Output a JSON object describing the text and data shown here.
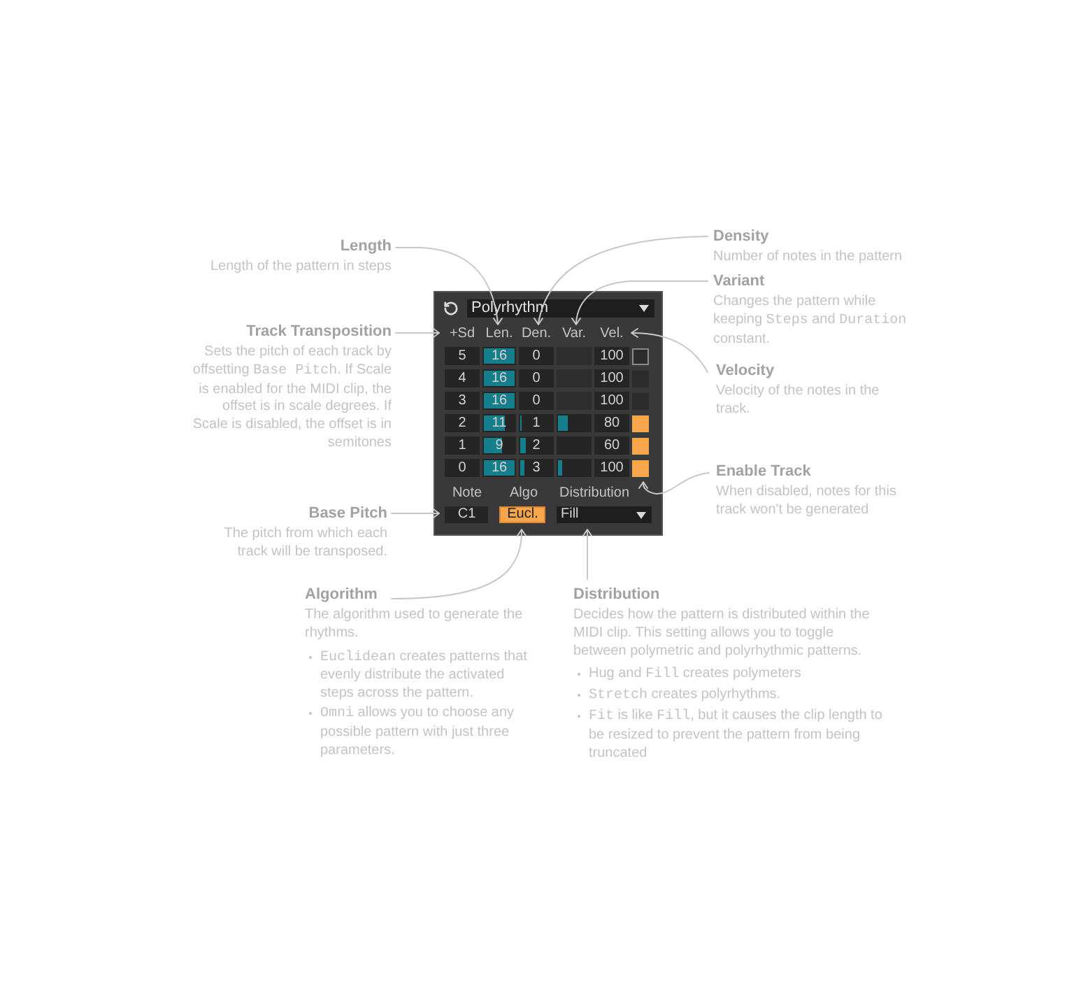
{
  "device": {
    "preset": "Polyrhythm",
    "columns": [
      "+Sd",
      "Len.",
      "Den.",
      "Var.",
      "Vel."
    ],
    "tracks": [
      {
        "transpose": "5",
        "length": {
          "value": "16",
          "level": 1
        },
        "density": {
          "value": "0"
        },
        "velocity": "100",
        "enabled": false,
        "focused": true
      },
      {
        "transpose": "4",
        "length": {
          "value": "16",
          "level": 1
        },
        "density": {
          "value": "0"
        },
        "velocity": "100",
        "enabled": false,
        "focused": false
      },
      {
        "transpose": "3",
        "length": {
          "value": "16",
          "level": 1
        },
        "density": {
          "value": "0"
        },
        "velocity": "100",
        "enabled": false,
        "focused": false
      },
      {
        "transpose": "2",
        "length": {
          "value": "11",
          "level": 0.67
        },
        "density": {
          "value": "1",
          "level": 0.05
        },
        "variant": {
          "level": 0.3
        },
        "velocity": "80",
        "enabled": true,
        "focused": false
      },
      {
        "transpose": "1",
        "length": {
          "value": "9",
          "level": 0.58
        },
        "density": {
          "value": "2",
          "level": 0.17
        },
        "velocity": "60",
        "enabled": true,
        "focused": false
      },
      {
        "transpose": "0",
        "length": {
          "value": "16",
          "level": 1
        },
        "density": {
          "value": "3",
          "level": 0.15
        },
        "variant": {
          "level": 0.15
        },
        "velocity": "100",
        "enabled": true,
        "focused": false
      }
    ],
    "note": {
      "label": "Note",
      "value": "C1"
    },
    "algorithm": {
      "label": "Algo",
      "value": "Eucl.",
      "on": true
    },
    "distribution": {
      "label": "Distribution",
      "value": "Fill"
    }
  },
  "annotations": [
    {
      "title": "Length",
      "body": [
        {
          "text": "Length of the pattern in steps",
          "kind": "text"
        }
      ]
    },
    {
      "title": "Track Transposition",
      "body": [
        {
          "text": "Sets the pitch of each track by offsetting ",
          "kind": "text"
        },
        {
          "text": "Base Pitch",
          "kind": "code"
        },
        {
          "text": ". If Scale is enabled for the MIDI clip, the offset is in scale degrees. If Scale is disabled, the offset is in semitones",
          "kind": "text"
        }
      ]
    },
    {
      "title": "Base Pitch",
      "body": [
        {
          "text": "The pitch from which each track will be transposed.",
          "kind": "text"
        }
      ]
    },
    {
      "title": "Density",
      "body": [
        {
          "text": "Number of notes in the pattern",
          "kind": "text"
        }
      ]
    },
    {
      "title": "Variant",
      "body": [
        {
          "text": "Changes the pattern while keeping ",
          "kind": "text"
        },
        {
          "text": "Steps",
          "kind": "code"
        },
        {
          "text": " and ",
          "kind": "text"
        },
        {
          "text": "Duration",
          "kind": "code"
        },
        {
          "text": " constant.",
          "kind": "text"
        }
      ]
    },
    {
      "title": "Velocity",
      "body": [
        {
          "text": "Velocity of the notes in the track.",
          "kind": "text"
        }
      ]
    },
    {
      "title": "Enable Track",
      "body": [
        {
          "text": "When disabled, notes for this track won't be generated",
          "kind": "text"
        }
      ]
    },
    {
      "title": "Algorithm",
      "body": [
        {
          "text": "The algorithm used to generate the rhythms.",
          "kind": "text"
        }
      ],
      "bullets": [
        [
          {
            "text": "Euclidean",
            "kind": "code"
          },
          {
            "text": " creates patterns that evenly distribute the activated steps across the pattern.",
            "kind": "text"
          }
        ],
        [
          {
            "text": "Omni",
            "kind": "code"
          },
          {
            "text": " allows you to choose any possible pattern with just three parameters.",
            "kind": "text"
          }
        ]
      ]
    },
    {
      "title": "Distribution",
      "body": [
        {
          "text": "Decides how the pattern is distributed within the MIDI clip. This setting allows you to toggle between polymetric and polyrhythmic patterns.",
          "kind": "text"
        }
      ],
      "bullets": [
        [
          {
            "text": "Hug and ",
            "kind": "text"
          },
          {
            "text": "Fill",
            "kind": "code"
          },
          {
            "text": " creates polymeters",
            "kind": "text"
          }
        ],
        [
          {
            "text": "Stretch",
            "kind": "code"
          },
          {
            "text": " creates polyrhythms.",
            "kind": "text"
          }
        ],
        [
          {
            "text": "Fit",
            "kind": "code"
          },
          {
            "text": " is like ",
            "kind": "text"
          },
          {
            "text": "Fill",
            "kind": "code"
          },
          {
            "text": ", but it causes the clip length to be resized to prevent the pattern from being truncated",
            "kind": "text"
          }
        ]
      ]
    }
  ]
}
